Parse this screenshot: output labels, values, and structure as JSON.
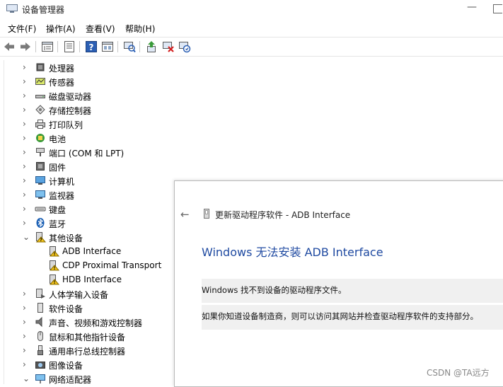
{
  "window": {
    "title": "设备管理器",
    "minimize_glyph": "—"
  },
  "menu": [
    "文件(F)",
    "操作(A)",
    "查看(V)",
    "帮助(H)"
  ],
  "toolbar": {
    "buttons": [
      "back-arrow-icon",
      "forward-arrow-icon",
      "device-tree-icon",
      "properties-icon",
      "help-icon",
      "view-icon",
      "scan-hardware-icon",
      "update-driver-icon",
      "uninstall-device-icon",
      "disable-device-icon"
    ]
  },
  "tree": [
    {
      "label": "处理器",
      "chevron": "›",
      "icon": "processor-icon",
      "level": 0
    },
    {
      "label": "传感器",
      "chevron": "›",
      "icon": "sensor-icon",
      "level": 0
    },
    {
      "label": "磁盘驱动器",
      "chevron": "›",
      "icon": "disk-drive-icon",
      "level": 0
    },
    {
      "label": "存储控制器",
      "chevron": "›",
      "icon": "storage-controller-icon",
      "level": 0
    },
    {
      "label": "打印队列",
      "chevron": "›",
      "icon": "printer-icon",
      "level": 0
    },
    {
      "label": "电池",
      "chevron": "›",
      "icon": "battery-icon",
      "level": 0
    },
    {
      "label": "端口 (COM 和 LPT)",
      "chevron": "›",
      "icon": "port-icon",
      "level": 0
    },
    {
      "label": "固件",
      "chevron": "›",
      "icon": "firmware-icon",
      "level": 0
    },
    {
      "label": "计算机",
      "chevron": "›",
      "icon": "computer-icon",
      "level": 0
    },
    {
      "label": "监视器",
      "chevron": "›",
      "icon": "monitor-icon",
      "level": 0
    },
    {
      "label": "键盘",
      "chevron": "›",
      "icon": "keyboard-icon",
      "level": 0
    },
    {
      "label": "蓝牙",
      "chevron": "›",
      "icon": "bluetooth-icon",
      "level": 0
    },
    {
      "label": "其他设备",
      "chevron": "⌄",
      "icon": "unknown-device-icon",
      "level": 0
    },
    {
      "label": "ADB Interface",
      "chevron": "",
      "icon": "warning-device-icon",
      "level": 1
    },
    {
      "label": "CDP Proximal Transport",
      "chevron": "",
      "icon": "warning-device-icon",
      "level": 1
    },
    {
      "label": "HDB Interface",
      "chevron": "",
      "icon": "warning-device-icon",
      "level": 1
    },
    {
      "label": "人体学输入设备",
      "chevron": "›",
      "icon": "hid-icon",
      "level": 0
    },
    {
      "label": "软件设备",
      "chevron": "›",
      "icon": "software-device-icon",
      "level": 0
    },
    {
      "label": "声音、视频和游戏控制器",
      "chevron": "›",
      "icon": "sound-icon",
      "level": 0
    },
    {
      "label": "鼠标和其他指针设备",
      "chevron": "›",
      "icon": "mouse-icon",
      "level": 0
    },
    {
      "label": "通用串行总线控制器",
      "chevron": "›",
      "icon": "usb-icon",
      "level": 0
    },
    {
      "label": "图像设备",
      "chevron": "›",
      "icon": "camera-icon",
      "level": 0
    },
    {
      "label": "网络适配器",
      "chevron": "⌄",
      "icon": "network-adapter-icon",
      "level": 0
    }
  ],
  "dialog": {
    "back_glyph": "←",
    "header": "更新驱动程序软件 - ADB Interface",
    "heading": "Windows 无法安装 ADB Interface",
    "message1": "Windows 找不到设备的驱动程序文件。",
    "message2": "如果你知道设备制造商，则可以访问其网站并检查驱动程序软件的支持部分。"
  },
  "watermark": "CSDN @TA远方",
  "colors": {
    "heading": "#1f4aa1",
    "message_bg": "#f0f0f0",
    "warning": "#f5c518"
  }
}
